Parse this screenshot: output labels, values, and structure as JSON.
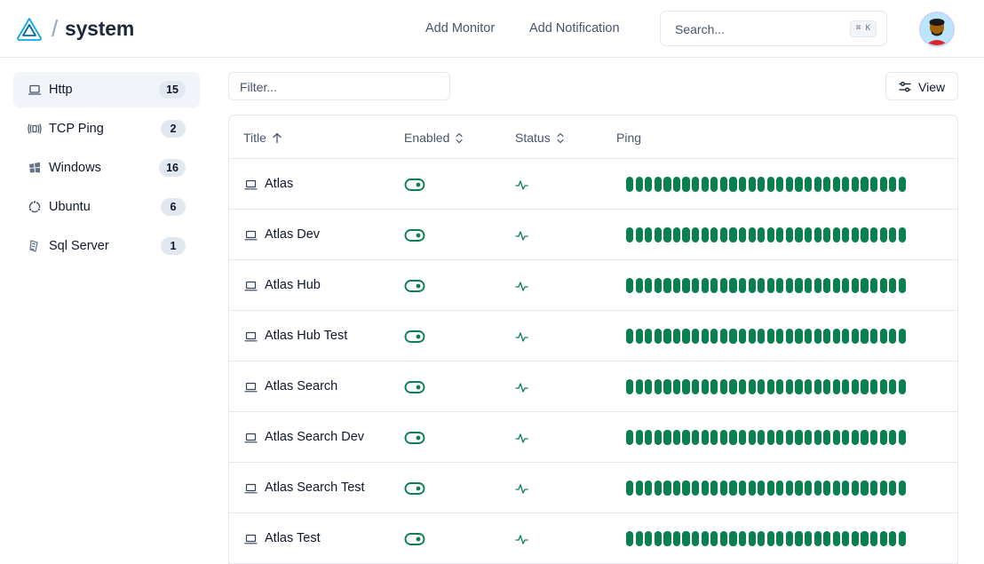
{
  "header": {
    "brand_slash": "/",
    "brand_name": "system",
    "nav": [
      {
        "label": "Add Monitor"
      },
      {
        "label": "Add Notification"
      }
    ],
    "search": {
      "placeholder": "Search...",
      "shortcut": "⌘ K"
    },
    "avatar_icon": "user-avatar"
  },
  "sidebar": {
    "items": [
      {
        "label": "Http",
        "count": "15",
        "icon": "laptop-icon",
        "active": true
      },
      {
        "label": "TCP Ping",
        "count": "2",
        "icon": "broadcast-icon",
        "active": false
      },
      {
        "label": "Windows",
        "count": "16",
        "icon": "windows-icon",
        "active": false
      },
      {
        "label": "Ubuntu",
        "count": "6",
        "icon": "ubuntu-icon",
        "active": false
      },
      {
        "label": "Sql Server",
        "count": "1",
        "icon": "database-icon",
        "active": false
      }
    ]
  },
  "toolbar": {
    "filter_placeholder": "Filter...",
    "view_label": "View"
  },
  "table": {
    "columns": [
      {
        "label": "Title",
        "sort": "ascending"
      },
      {
        "label": "Enabled",
        "sort": "none"
      },
      {
        "label": "Status",
        "sort": "none"
      },
      {
        "label": "Ping"
      }
    ],
    "rows": [
      {
        "title": "Atlas",
        "enabled": true,
        "status": "up",
        "ping_bars": 30
      },
      {
        "title": "Atlas Dev",
        "enabled": true,
        "status": "up",
        "ping_bars": 30
      },
      {
        "title": "Atlas Hub",
        "enabled": true,
        "status": "up",
        "ping_bars": 30
      },
      {
        "title": "Atlas Hub Test",
        "enabled": true,
        "status": "up",
        "ping_bars": 30
      },
      {
        "title": "Atlas Search",
        "enabled": true,
        "status": "up",
        "ping_bars": 30
      },
      {
        "title": "Atlas Search Dev",
        "enabled": true,
        "status": "up",
        "ping_bars": 30
      },
      {
        "title": "Atlas Search Test",
        "enabled": true,
        "status": "up",
        "ping_bars": 30
      },
      {
        "title": "Atlas Test",
        "enabled": true,
        "status": "up",
        "ping_bars": 30
      }
    ]
  },
  "colors": {
    "accent_green": "#0a7f4f",
    "logo_blue": "#0ea5e9",
    "badge_bg": "#e2e8f0"
  }
}
